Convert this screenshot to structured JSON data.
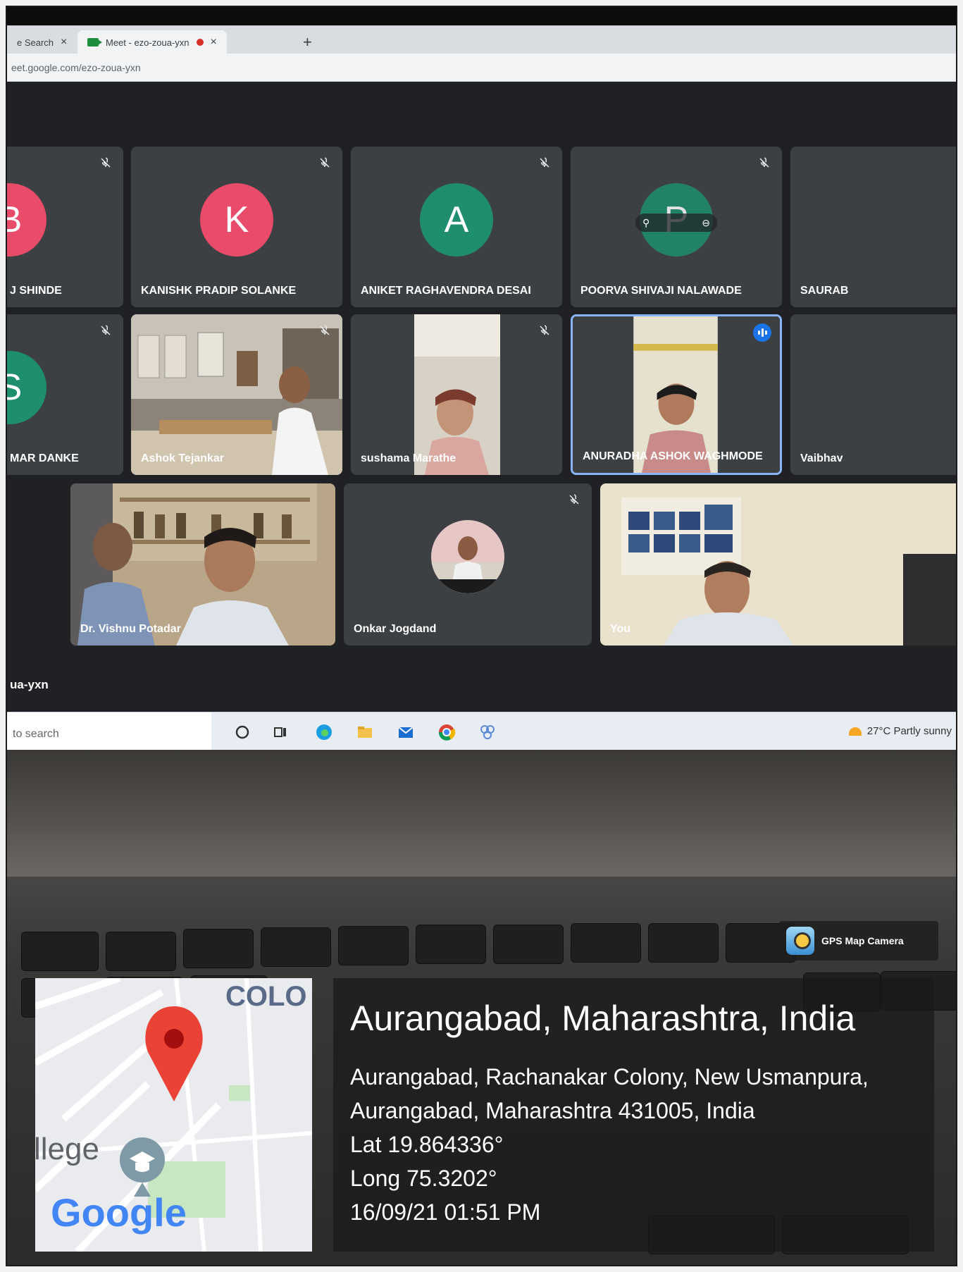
{
  "browser": {
    "tabs": [
      {
        "label": "e Search",
        "active": false
      },
      {
        "label": "Meet - ezo-zoua-yxn",
        "active": true
      }
    ],
    "url": "eet.google.com/ezo-zoua-yxn"
  },
  "meet": {
    "meeting_code": "ua-yxn",
    "row1": [
      {
        "initial": "B",
        "name": "J SHINDE",
        "color": "#e94b6a"
      },
      {
        "initial": "K",
        "name": "KANISHK PRADIP SOLANKE",
        "color": "#e94b6a"
      },
      {
        "initial": "A",
        "name": "ANIKET RAGHAVENDRA DESAI",
        "color": "#1e8e6e"
      },
      {
        "initial": "P",
        "name": "POORVA SHIVAJI NALAWADE",
        "color": "#1e8e6e"
      },
      {
        "initial": "",
        "name": "SAURAB",
        "color": "#3c4043"
      }
    ],
    "row2": [
      {
        "initial": "S",
        "name": "MAR DANKE",
        "color": "#1e8e6e"
      },
      {
        "name": "Ashok Tejankar"
      },
      {
        "name": "sushama Marathe"
      },
      {
        "name": "ANURADHA ASHOK WAGHMODE"
      },
      {
        "name": "Vaibhav"
      }
    ],
    "row3": [
      {
        "name": "Dr. Vishnu Potadar"
      },
      {
        "name": "Onkar Jogdand"
      },
      {
        "name": "You"
      }
    ]
  },
  "taskbar": {
    "search_placeholder": "to search",
    "weather": "27°C  Partly sunny"
  },
  "overlay": {
    "app_name": "GPS Map Camera",
    "location_title": "Aurangabad, Maharashtra, India",
    "address_line1": "Aurangabad, Rachanakar Colony, New Usmanpura,",
    "address_line2": "Aurangabad, Maharashtra 431005, India",
    "lat": "Lat 19.864336°",
    "long": "Long 75.3202°",
    "datetime": "16/09/21 01:51 PM",
    "map_label_colony": "COLO",
    "map_label_college": "llege",
    "map_brand": "Google"
  },
  "colors": {
    "meet_bg": "#202124",
    "tile_bg": "#3c4043",
    "end_call": "#ea4335",
    "speaking_border": "#8ab4f8"
  }
}
